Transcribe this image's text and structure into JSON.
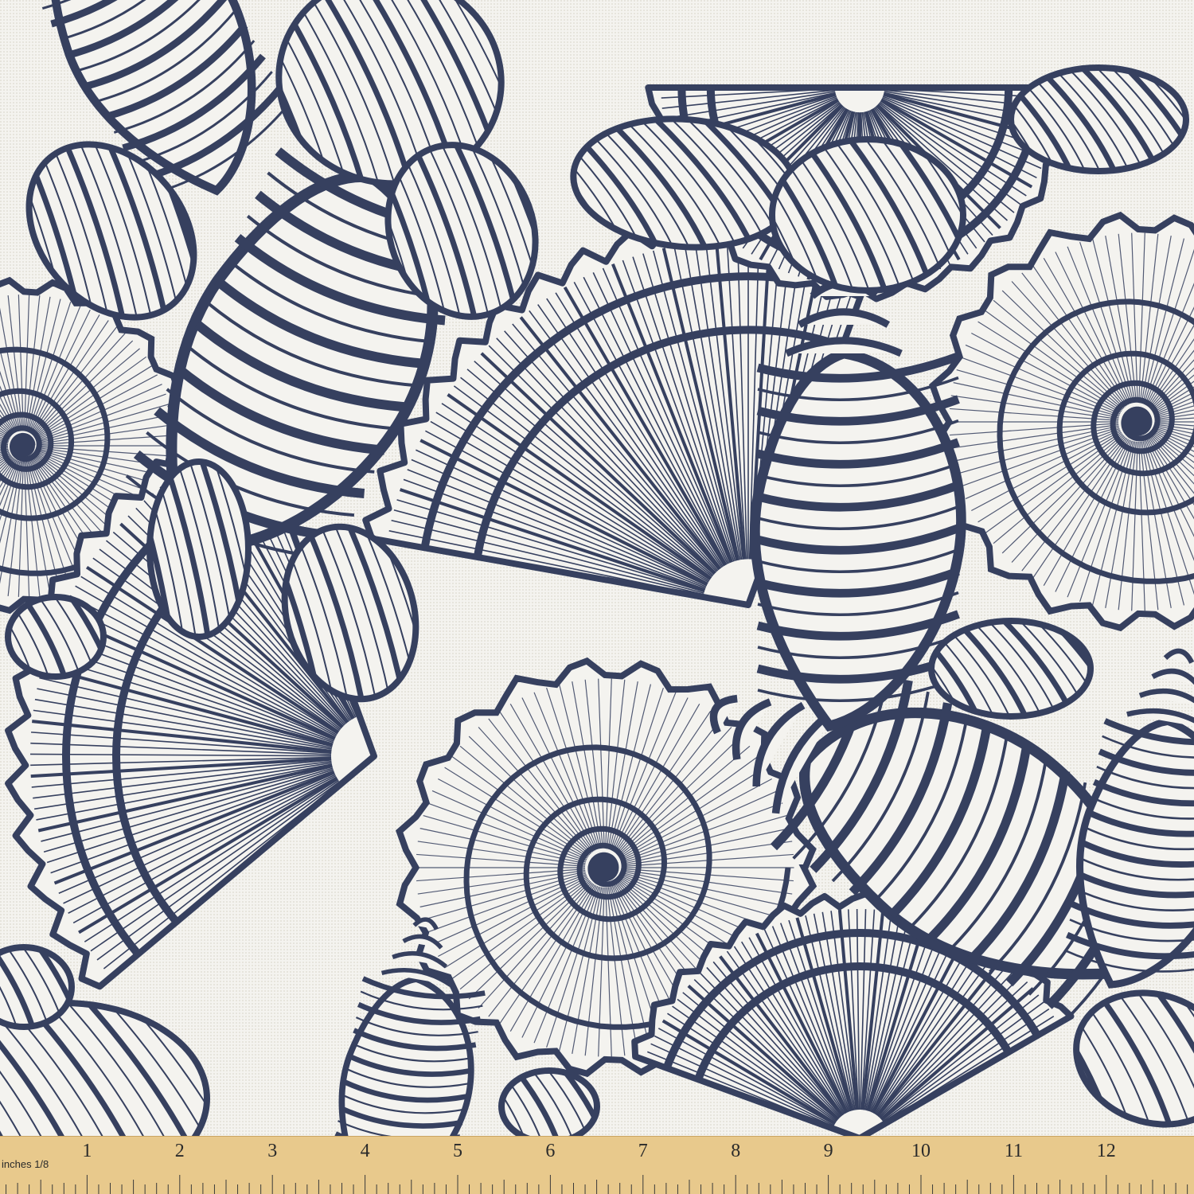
{
  "fabric": {
    "background": "#f4f3ef",
    "ink": "#36405f",
    "weave_texture": "#e6e4dc"
  },
  "motifs": [
    {
      "type": "scallop-shell"
    },
    {
      "type": "spiral-ammonite-shell"
    },
    {
      "type": "conch-shell"
    },
    {
      "type": "whelk-shell"
    },
    {
      "type": "cowrie-shell"
    }
  ],
  "ruler": {
    "color": "#e8c98c",
    "edge": "#c9a463",
    "unit_label": "inches 1/8",
    "numbers": [
      "1",
      "2",
      "3",
      "4",
      "5",
      "6",
      "7",
      "8",
      "9",
      "10",
      "11",
      "12",
      "1"
    ]
  }
}
